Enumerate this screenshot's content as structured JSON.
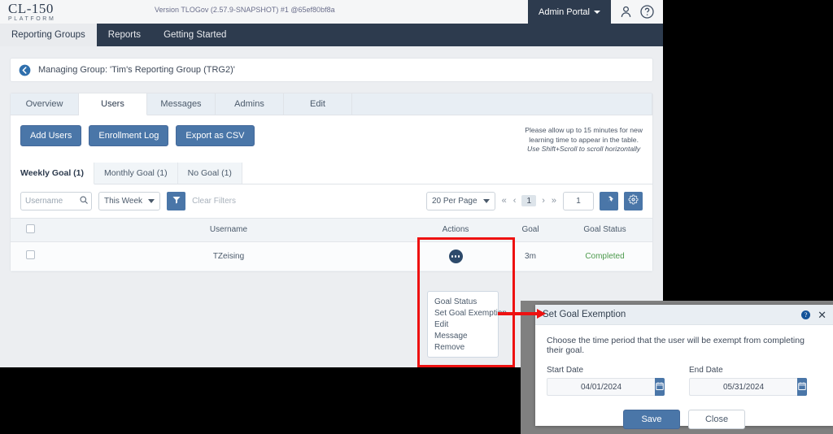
{
  "header": {
    "logo_line1": "CL-150",
    "logo_line2": "PLATFORM",
    "version": "Version TLOGov (2.57.9-SNAPSHOT) #1 @65ef80bf8a",
    "admin_portal": "Admin Portal",
    "user_icon": "user-icon",
    "help_icon": "help-icon"
  },
  "nav": {
    "items": [
      {
        "label": "Reporting Groups",
        "active": true
      },
      {
        "label": "Reports",
        "active": false
      },
      {
        "label": "Getting Started",
        "active": false
      }
    ]
  },
  "banner": {
    "back_icon": "back-arrow-icon",
    "text": "Managing Group: 'Tim's Reporting Group (TRG2)'"
  },
  "tabs": [
    {
      "label": "Overview",
      "active": false
    },
    {
      "label": "Users",
      "active": true
    },
    {
      "label": "Messages",
      "active": false
    },
    {
      "label": "Admins",
      "active": false
    },
    {
      "label": "Edit",
      "active": false
    }
  ],
  "actions": {
    "add_users": "Add Users",
    "enrollment_log": "Enrollment Log",
    "export_csv": "Export as CSV"
  },
  "notice": {
    "line1": "Please allow up to 15 minutes for new",
    "line2": "learning time to appear in the table.",
    "line3": "Use Shift+Scroll to scroll horizontally"
  },
  "subtabs": [
    {
      "label": "Weekly Goal (1)",
      "active": true
    },
    {
      "label": "Monthly Goal (1)",
      "active": false
    },
    {
      "label": "No Goal (1)",
      "active": false
    }
  ],
  "filters": {
    "search_placeholder": "Username",
    "search_value": "",
    "search_icon": "search-icon",
    "period_select": "This Week",
    "funnel_icon": "funnel-icon",
    "clear_filters": "Clear Filters"
  },
  "pagination": {
    "per_page": "20 Per Page",
    "first": "«",
    "prev": "‹",
    "current_page": "1",
    "next": "›",
    "last": "»",
    "page_input_value": "1",
    "pin_icon": "pin-icon",
    "gear_icon": "gear-icon"
  },
  "table": {
    "columns": [
      "",
      "Username",
      "Actions",
      "Goal",
      "Goal Status"
    ],
    "rows": [
      {
        "username": "TZeising",
        "actions_icon": "ellipsis-icon",
        "goal": "3m",
        "goal_status": "Completed"
      }
    ]
  },
  "context_menu": {
    "items": [
      "Goal Status",
      "Set Goal Exemption",
      "Edit",
      "Message",
      "Remove"
    ]
  },
  "modal": {
    "title": "Set Goal Exemption",
    "info_icon": "info-icon",
    "close_icon": "close-icon",
    "description": "Choose the time period that the user will be exempt from completing their goal.",
    "start_label": "Start Date",
    "start_value": "04/01/2024",
    "end_label": "End Date",
    "end_value": "05/31/2024",
    "calendar_icon": "calendar-icon",
    "save": "Save",
    "close": "Close"
  },
  "colors": {
    "nav_dark": "#2d3b4e",
    "primary_blue": "#4a76a8",
    "annotation_red": "#ee1111",
    "status_green": "#4c9a4c"
  }
}
